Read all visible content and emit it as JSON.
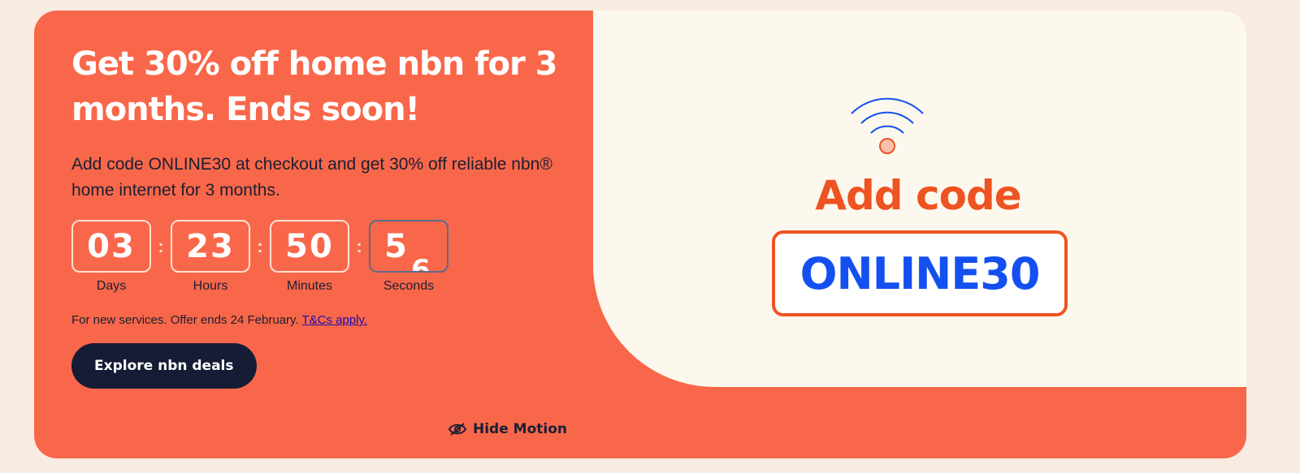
{
  "promo": {
    "headline": "Get 30% off home nbn for 3 months. Ends soon!",
    "subtext": "Add code ONLINE30 at checkout and get 30% off reliable nbn® home internet for 3 months.",
    "countdown": {
      "days": "03",
      "days_label": "Days",
      "hours": "23",
      "hours_label": "Hours",
      "minutes": "50",
      "minutes_label": "Minutes",
      "seconds": "5",
      "seconds_next": "6",
      "seconds_label": "Seconds",
      "separator": ":"
    },
    "fineprint": "For new services. Offer ends 24 February.",
    "terms_link": "T&Cs apply.",
    "cta_label": "Explore nbn deals",
    "hide_motion_label": "Hide Motion"
  },
  "graphic": {
    "add_code_label": "Add code",
    "code": "ONLINE30"
  },
  "colors": {
    "background": "#f8ece2",
    "banner": "#f9674a",
    "panel": "#fdf8ee",
    "accent_orange": "#ee5322",
    "code_blue": "#1450f0",
    "button_navy": "#161c35"
  },
  "icons": {
    "hide_motion": "eye-slash-icon",
    "wifi": "wifi-icon"
  }
}
